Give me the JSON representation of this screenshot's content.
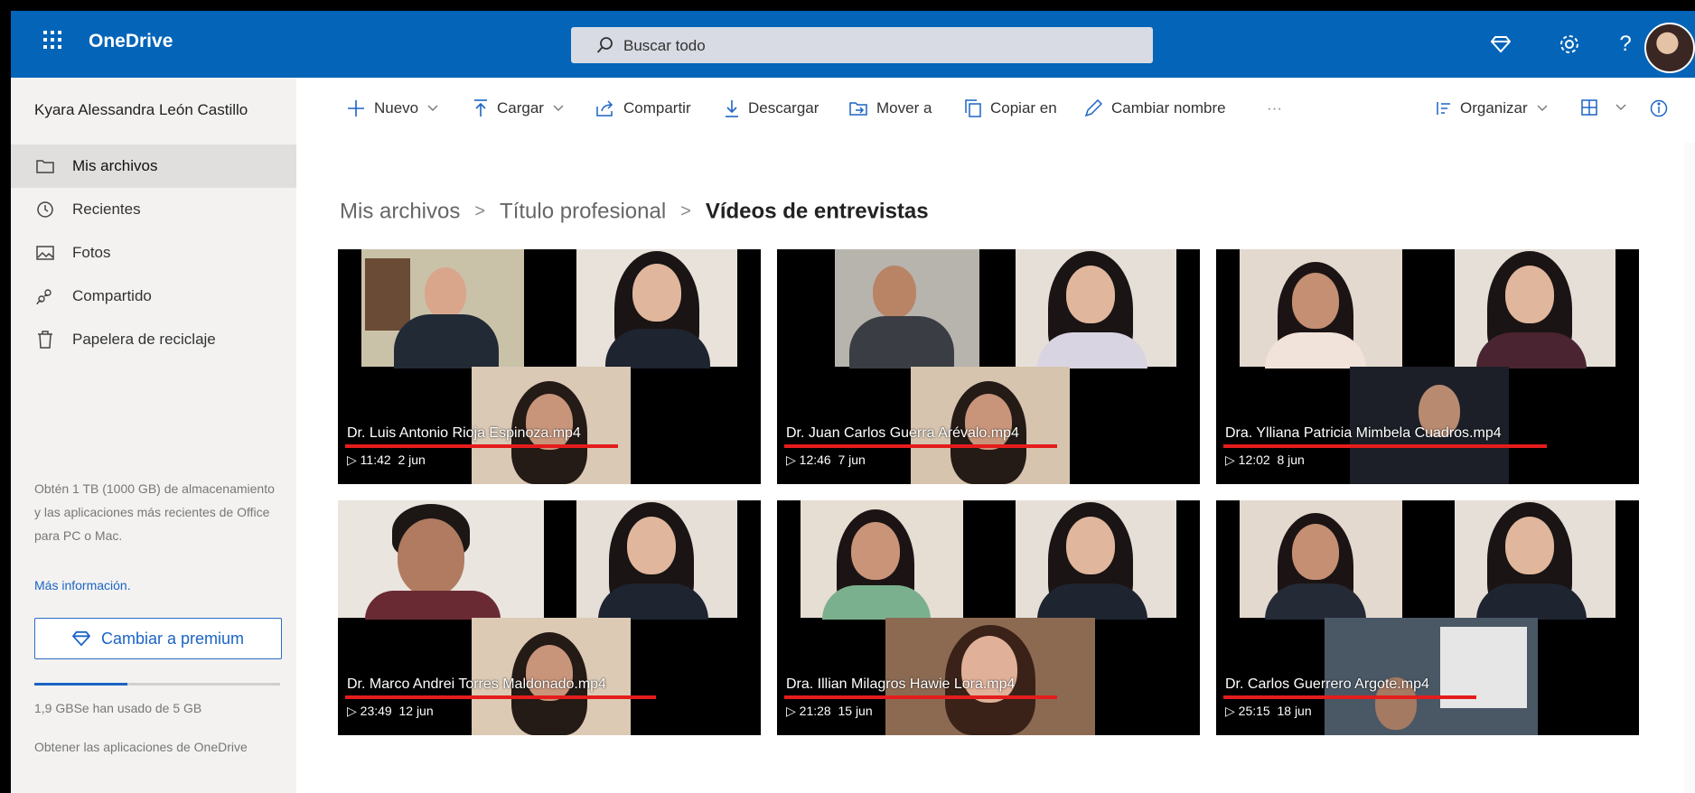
{
  "app": {
    "name": "OneDrive"
  },
  "search": {
    "placeholder": "Buscar todo"
  },
  "colors": {
    "brand": "#0364b8",
    "accent": "#1c64c4",
    "underline": "#e51c1c"
  },
  "topbar_icons": [
    "diamond-icon",
    "gear-icon",
    "help-icon",
    "avatar"
  ],
  "sidebar": {
    "owner": "Kyara Alessandra León Castillo",
    "items": [
      {
        "label": "Mis archivos",
        "icon": "folder-icon",
        "active": true
      },
      {
        "label": "Recientes",
        "icon": "clock-icon",
        "active": false
      },
      {
        "label": "Fotos",
        "icon": "photo-icon",
        "active": false
      },
      {
        "label": "Compartido",
        "icon": "share-people-icon",
        "active": false
      },
      {
        "label": "Papelera de reciclaje",
        "icon": "trash-icon",
        "active": false
      }
    ],
    "promo": "Obtén 1 TB (1000 GB) de almacenamiento y las aplicaciones más recientes de Office para PC o Mac.",
    "promo_link": "Más información.",
    "premium_button": "Cambiar a premium",
    "storage_text": "1,9 GBSe han usado de 5 GB",
    "storage_fraction": 0.38,
    "get_apps": "Obtener las aplicaciones de OneDrive"
  },
  "commands": {
    "nuevo": "Nuevo",
    "cargar": "Cargar",
    "compartir": "Compartir",
    "descargar": "Descargar",
    "mover": "Mover a",
    "copiar": "Copiar en",
    "renombrar": "Cambiar nombre",
    "more": "···",
    "organizar": "Organizar"
  },
  "breadcrumb": [
    "Mis archivos",
    "Título profesional",
    "Vídeos de entrevistas"
  ],
  "breadcrumb_sep": ">",
  "files": [
    {
      "name": "Dr. Luis Antonio Rioja Espinoza.mp4",
      "duration": "▷ 11:42",
      "date": "2 jun"
    },
    {
      "name": "Dr. Juan Carlos Guerra Arévalo.mp4",
      "duration": "▷ 12:46",
      "date": "7 jun"
    },
    {
      "name": "Dra. Ylliana Patricia Mimbela Cuadros.mp4",
      "duration": "▷ 12:02",
      "date": "8 jun"
    },
    {
      "name": "Dr. Marco Andrei Torres Maldonado.mp4",
      "duration": "▷ 23:49",
      "date": "12 jun"
    },
    {
      "name": "Dra. Illian Milagros Hawie Lora.mp4",
      "duration": "▷ 21:28",
      "date": "15 jun"
    },
    {
      "name": "Dr. Carlos Guerrero Argote.mp4",
      "duration": "▷ 25:15",
      "date": "18 jun"
    }
  ]
}
